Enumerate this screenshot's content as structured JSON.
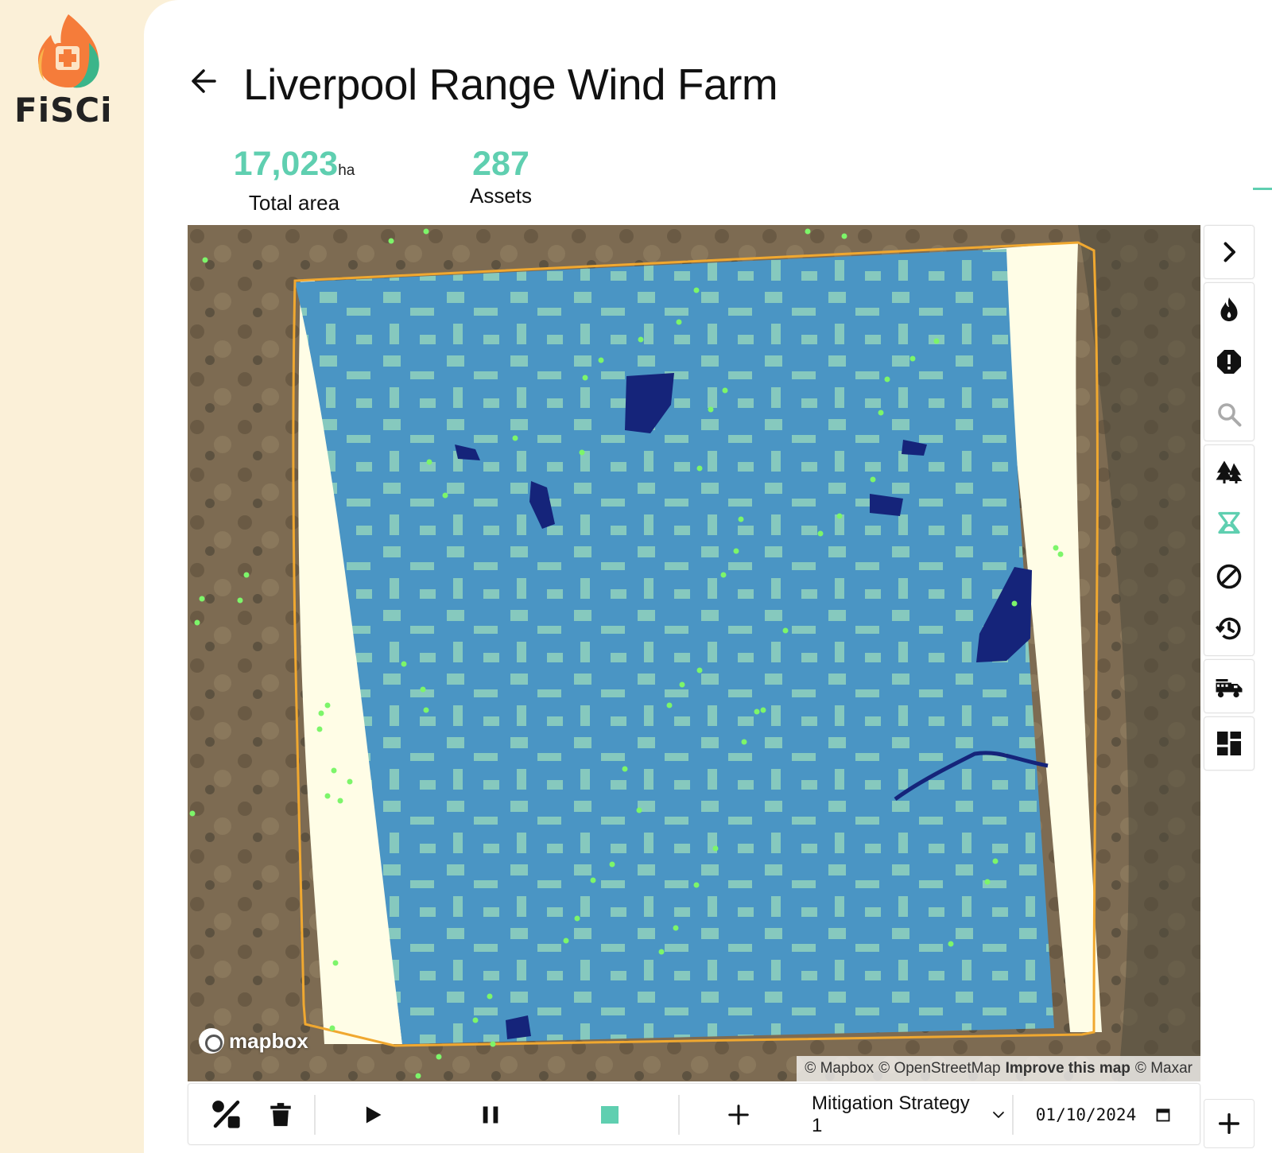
{
  "app": {
    "logo_text": "FiSCi",
    "logo_icon": "fisci-flame-logo",
    "brand_accent": "#5fcfb0",
    "sidebar_bg": "#fbf0d8"
  },
  "header": {
    "back_icon": "arrow-left-icon",
    "title": "Liverpool Range Wind Farm"
  },
  "stats": {
    "area": {
      "value": "17,023",
      "unit": "ha",
      "label": "Total area"
    },
    "assets": {
      "value": "287",
      "label": "Assets"
    }
  },
  "map": {
    "legend_colors": {
      "imagery_bg": "#7a6a52",
      "raster_mid": "#4a95c4",
      "raster_light": "#86c9be",
      "raster_dark": "#15247a",
      "edge_band": "#fffde6",
      "boundary": "#f0a830",
      "asset_points": "#7df56a"
    },
    "logo_text": "mapbox",
    "attribution": {
      "mapbox": "© Mapbox",
      "osm": "© OpenStreetMap",
      "improve": "Improve this map",
      "maxar": "© Maxar"
    }
  },
  "right_toolbar": {
    "collapse_icon": "chevron-right-icon",
    "tools": [
      {
        "name": "fire-icon"
      },
      {
        "name": "alert-octagon-icon"
      },
      {
        "name": "search-icon"
      },
      {
        "name": "trees-icon"
      },
      {
        "name": "fire-behaviour-icon"
      },
      {
        "name": "block-icon"
      },
      {
        "name": "history-icon"
      },
      {
        "name": "fire-truck-icon"
      },
      {
        "name": "dashboard-icon"
      }
    ],
    "add_icon": "plus-icon"
  },
  "bottom_bar": {
    "draw_icon": "shapes-icon",
    "delete_icon": "trash-icon",
    "play_icon": "play-icon",
    "pause_icon": "pause-icon",
    "stop_color": "#5fcfb0",
    "add_icon": "plus-icon",
    "strategy": {
      "selected": "Mitigation Strategy 1"
    },
    "date": {
      "value": "01/10/2024"
    }
  }
}
